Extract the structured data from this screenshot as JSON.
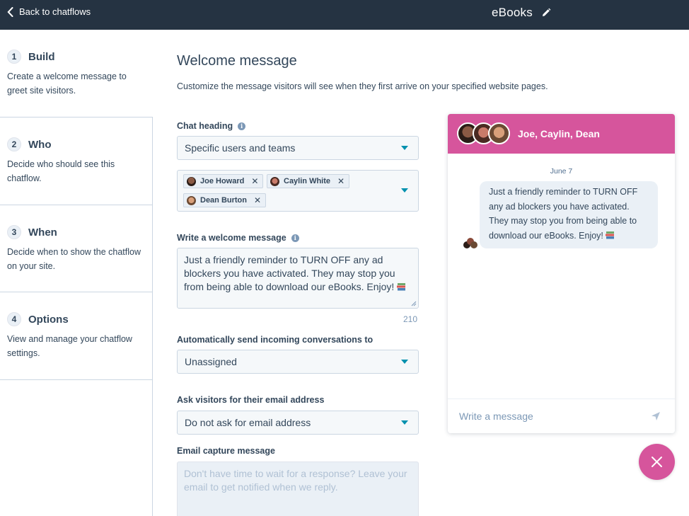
{
  "topbar": {
    "back_label": "Back to chatflows",
    "title": "eBooks"
  },
  "steps": [
    {
      "number": "1",
      "name": "Build",
      "description": "Create a welcome message to greet site visitors."
    },
    {
      "number": "2",
      "name": "Who",
      "description": "Decide who should see this chatflow."
    },
    {
      "number": "3",
      "name": "When",
      "description": "Decide when to show the chatflow on your site."
    },
    {
      "number": "4",
      "name": "Options",
      "description": "View and manage your chatflow settings."
    }
  ],
  "form": {
    "heading": "Welcome message",
    "subheading": "Customize the message visitors will see when they first arrive on your specified website pages.",
    "chat_heading_label": "Chat heading",
    "chat_heading_value": "Specific users and teams",
    "users": [
      "Joe Howard",
      "Caylin White",
      "Dean Burton"
    ],
    "welcome_label": "Write a welcome message",
    "welcome_text": "Just a friendly reminder to TURN OFF any ad blockers you have activated. They may stop you from being able to download our eBooks. Enjoy!",
    "char_count": "210",
    "routing_label": "Automatically send incoming conversations to",
    "routing_value": "Unassigned",
    "email_label": "Ask visitors for their email address",
    "email_value": "Do not ask for email address",
    "capture_label": "Email capture message",
    "capture_placeholder": "Don't have time to wait for a response? Leave your email to get notified when we reply."
  },
  "preview": {
    "header_names": "Joe, Caylin, Dean",
    "date": "June 7",
    "message": "Just a friendly reminder to TURN OFF any ad blockers you have activated. They may stop you from being able to download our eBooks. Enjoy!",
    "input_placeholder": "Write a message"
  },
  "colors": {
    "topbar": "#253342",
    "accent_pink": "#d6559c",
    "caret_teal": "#0091ae"
  },
  "icons": [
    "chevron-left-icon",
    "pencil-icon",
    "info-icon",
    "caret-down-icon",
    "remove-x-icon",
    "books-emoji-icon",
    "send-icon",
    "close-icon"
  ]
}
